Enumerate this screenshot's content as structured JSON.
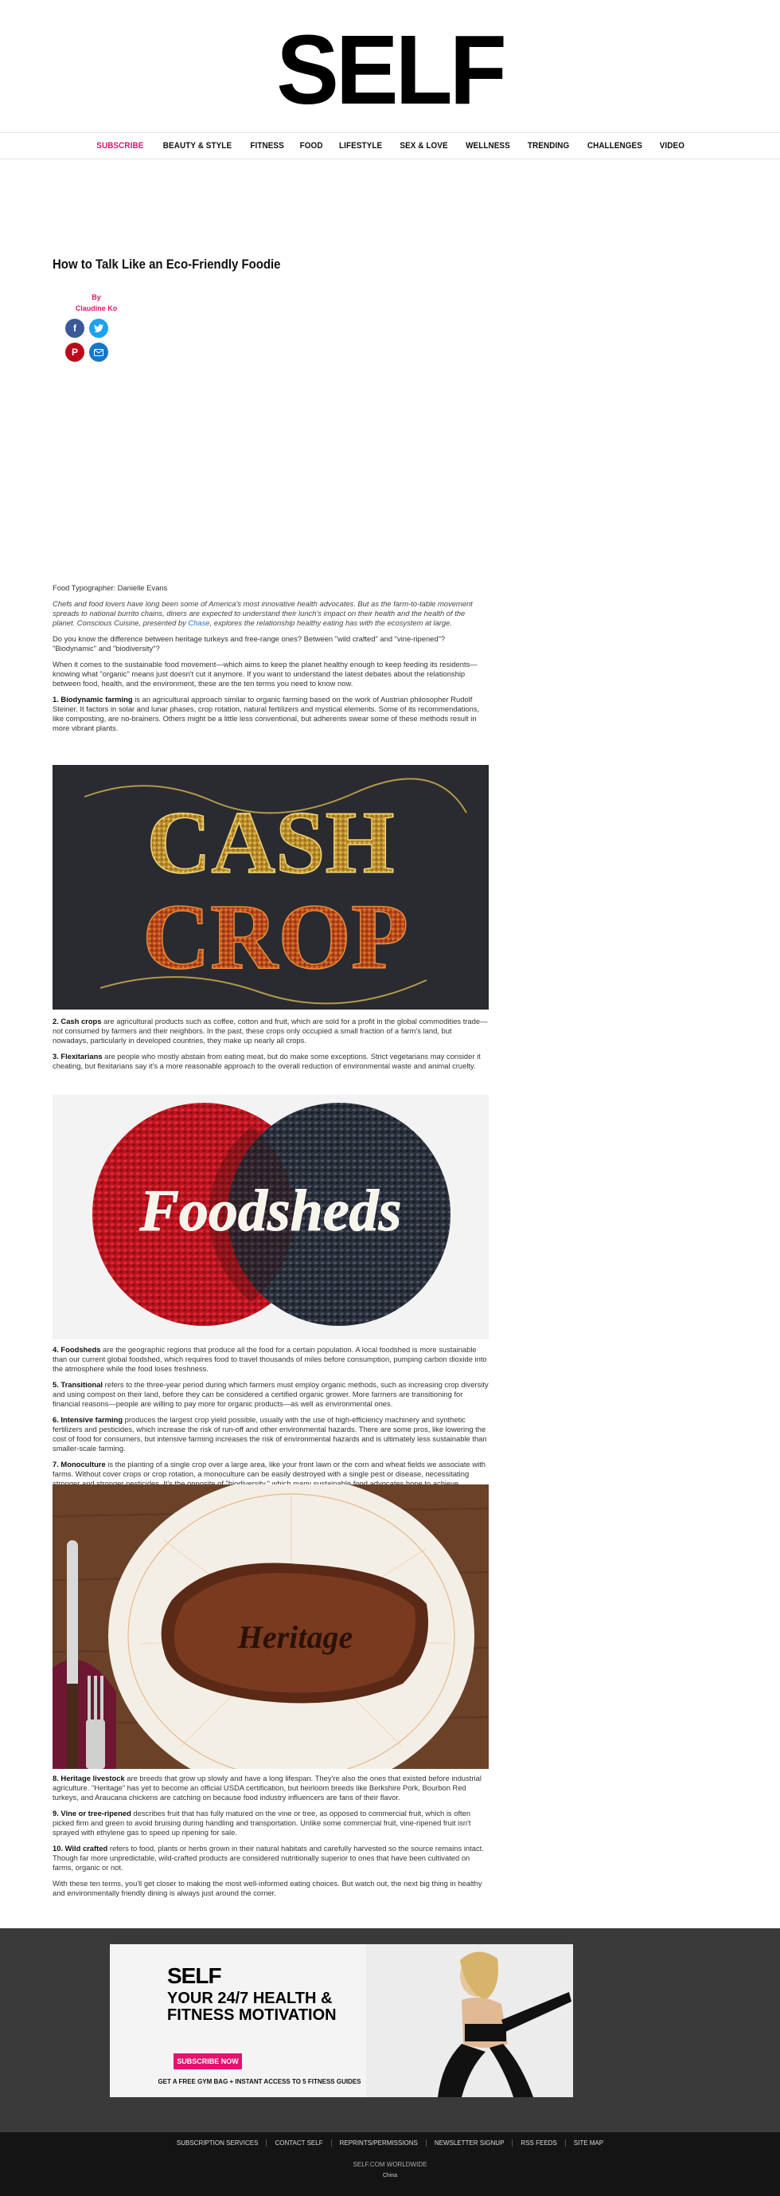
{
  "site": {
    "logo": "SELF"
  },
  "nav": [
    {
      "label": "SUBSCRIBE",
      "active": true
    },
    {
      "label": "BEAUTY & STYLE"
    },
    {
      "label": "FITNESS"
    },
    {
      "label": "FOOD"
    },
    {
      "label": "LIFESTYLE"
    },
    {
      "label": "SEX & LOVE"
    },
    {
      "label": "WELLNESS"
    },
    {
      "label": "TRENDING"
    },
    {
      "label": "CHALLENGES"
    },
    {
      "label": "VIDEO"
    }
  ],
  "article": {
    "title": "How to Talk Like an Eco-Friendly Foodie",
    "by": "By",
    "author": "Claudine Ko",
    "credit": "Food Typographer: Danielle Evans",
    "intro_italic": "Chefs and food lovers have long been some of America's most innovative health advocates. But as the farm-to-table movement spreads to national burrito chains, diners are expected to understand their lunch's impact on their health and the health of the planet. Conscious Cuisine, presented by",
    "intro_link": "Chase",
    "intro_end": ", explores the relationship healthy eating has with the ecosystem at large.",
    "p1": "Do you know the difference between heritage turkeys and free-range ones? Between \"wild crafted\" and \"vine-ripened\"? \"Biodynamic\" and \"biodiversity\"?",
    "p2": "When it comes to the sustainable food movement—which aims to keep the planet healthy enough to keep feeding its residents—knowing what \"organic\" means just doesn't cut it anymore. If you want to understand the latest debates about the relationship between food, health, and the environment, these are the ten terms you need to know now.",
    "terms": [
      {
        "term": "1. Biodynamic farming",
        "text": " is an agricultural approach similar to organic farming based on the work of Austrian philosopher Rudolf Steiner. It factors in solar and lunar phases, crop rotation, natural fertilizers and mystical elements. Some of its recommendations, like composting, are no-brainers. Others might be a little less conventional, but adherents swear some of these methods result in more vibrant plants."
      },
      {
        "term": "2. Cash crops",
        "text": " are agricultural products such as coffee, cotton and fruit, which are sold for a profit in the global commodities trade—not consumed by farmers and their neighbors. In the past, these crops only occupied a small fraction of a farm's land, but nowadays, particularly in developed countries, they make up nearly all crops."
      },
      {
        "term": "3. Flexitarians",
        "text": " are people who mostly abstain from eating meat, but do make some exceptions. Strict vegetarians may consider it cheating, but flexitarians say it's a more reasonable approach to the overall reduction of environmental waste and animal cruelty."
      },
      {
        "term": "4. Foodsheds",
        "text": " are the geographic regions that produce all the food for a certain population. A local foodshed is more sustainable than our current global foodshed, which requires food to travel thousands of miles before consumption, pumping carbon dioxide into the atmosphere while the food loses freshness."
      },
      {
        "term": "5. Transitional",
        "text": " refers to the three-year period during which farmers must employ organic methods, such as increasing crop diversity and using compost on their land, before they can be considered a certified organic grower. More farmers are transitioning for financial reasons—people are willing to pay more for organic products—as well as environmental ones."
      },
      {
        "term": "6. Intensive farming",
        "text": " produces the largest crop yield possible, usually with the use of high-efficiency machinery and synthetic fertilizers and pesticides, which increase the risk of run-off and other environmental hazards. There are some pros, like lowering the cost of food for consumers, but intensive farming increases the risk of environmental hazards and is ultimately less sustainable than smaller-scale farming."
      },
      {
        "term": "7. Monoculture",
        "text": " is the planting of a single crop over a large area, like your front lawn or the corn and wheat fields we associate with farms. Without cover crops or crop rotation, a monoculture can be easily destroyed with a single pest or disease, necessitating stronger and stronger pesticides. It's the opposite of \"biodiversity,\" which many sustainable food advocates hope to achieve."
      },
      {
        "term": "8. Heritage livestock",
        "text": " are breeds that grow up slowly and have a long lifespan. They're also the ones that existed before industrial agriculture. \"Heritage\" has yet to become an official USDA certification, but heirloom breeds like Berkshire Pork, Bourbon Red turkeys, and Araucana chickens are catching on because food industry influencers are fans of their flavor."
      },
      {
        "term": "9. Vine or tree-ripened",
        "text": " describes fruit that has fully matured on the vine or tree, as opposed to commercial fruit, which is often picked firm and green to avoid bruising during handling and transportation. Unlike some commercial fruit, vine-ripened fruit isn't sprayed with ethylene gas to speed up ripening for sale."
      },
      {
        "term": "10. Wild crafted",
        "text": " refers to food, plants or herbs grown in their natural habitats and carefully harvested so the source remains intact. Though far more unpredictable, wild-crafted products are considered nutritionally superior to ones that have been cultivated on farms, organic or not."
      }
    ],
    "closing": "With these ten terms, you'll get closer to making the most well-informed eating choices. But watch out, the next big thing in healthy and environmentally friendly dining is always just around the corner.",
    "fig1_words": [
      "CASH",
      "CROP"
    ],
    "fig2_word": "Foodsheds",
    "fig3_word": "Heritage"
  },
  "ad": {
    "logo": "SELF",
    "headline": "YOUR 24/7 HEALTH & FITNESS MOTIVATION",
    "button": "SUBSCRIBE NOW",
    "fine": "GET A FREE GYM BAG + INSTANT ACCESS TO 5 FITNESS GUIDES"
  },
  "footer": {
    "links": [
      "SUBSCRIPTION SERVICES",
      "CONTACT SELF",
      "REPRINTS/PERMISSIONS",
      "NEWSLETTER SIGNUP",
      "RSS FEEDS",
      "SITE MAP"
    ],
    "worldwide": "SELF.COM WORLDWIDE",
    "region": "China"
  },
  "colors": {
    "accent": "#e4126f",
    "facebook": "#3b5998",
    "twitter": "#1da1f2",
    "pinterest": "#bd081c"
  }
}
